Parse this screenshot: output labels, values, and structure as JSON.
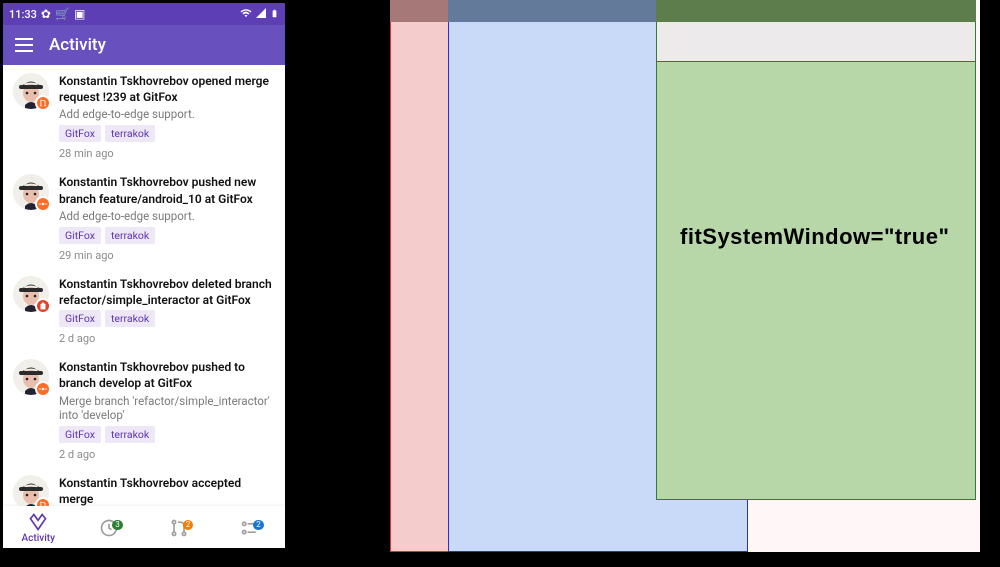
{
  "status_bar": {
    "time": "11:33",
    "icons_left": [
      "gear",
      "cart",
      "stop"
    ],
    "icons_right": [
      "wifi",
      "signal",
      "battery"
    ]
  },
  "toolbar": {
    "title": "Activity",
    "menu_label": "Menu"
  },
  "feed": [
    {
      "title": "Konstantin Tskhovrebov opened merge request !239 at GitFox",
      "desc": "Add edge-to-edge support.",
      "tags": [
        "GitFox",
        "terrakok"
      ],
      "time": "28 min ago",
      "badge": "orange",
      "badge_icon": "merge"
    },
    {
      "title": "Konstantin Tskhovrebov pushed new branch feature/android_10 at GitFox",
      "desc": "Add edge-to-edge support.",
      "tags": [
        "GitFox",
        "terrakok"
      ],
      "time": "29 min ago",
      "badge": "orange",
      "badge_icon": "commit"
    },
    {
      "title": "Konstantin Tskhovrebov deleted branch refactor/simple_interactor at GitFox",
      "desc": "",
      "tags": [
        "GitFox",
        "terrakok"
      ],
      "time": "2 d ago",
      "badge": "red",
      "badge_icon": "trash"
    },
    {
      "title": "Konstantin Tskhovrebov pushed to branch develop at GitFox",
      "desc": "Merge branch 'refactor/simple_interactor' into 'develop'",
      "tags": [
        "GitFox",
        "terrakok"
      ],
      "time": "2 d ago",
      "badge": "orange",
      "badge_icon": "commit"
    },
    {
      "title": "Konstantin Tskhovrebov accepted merge",
      "desc": "",
      "tags": [],
      "time": "",
      "badge": "orange",
      "badge_icon": "merge"
    }
  ],
  "bottom_nav": {
    "activity": {
      "label": "Activity"
    },
    "todo": {
      "badge": "3"
    },
    "mr": {
      "badge": "2"
    },
    "pipeline": {
      "badge": "2"
    }
  },
  "diagram": {
    "label": "fitSystemWindow=\"true\""
  }
}
